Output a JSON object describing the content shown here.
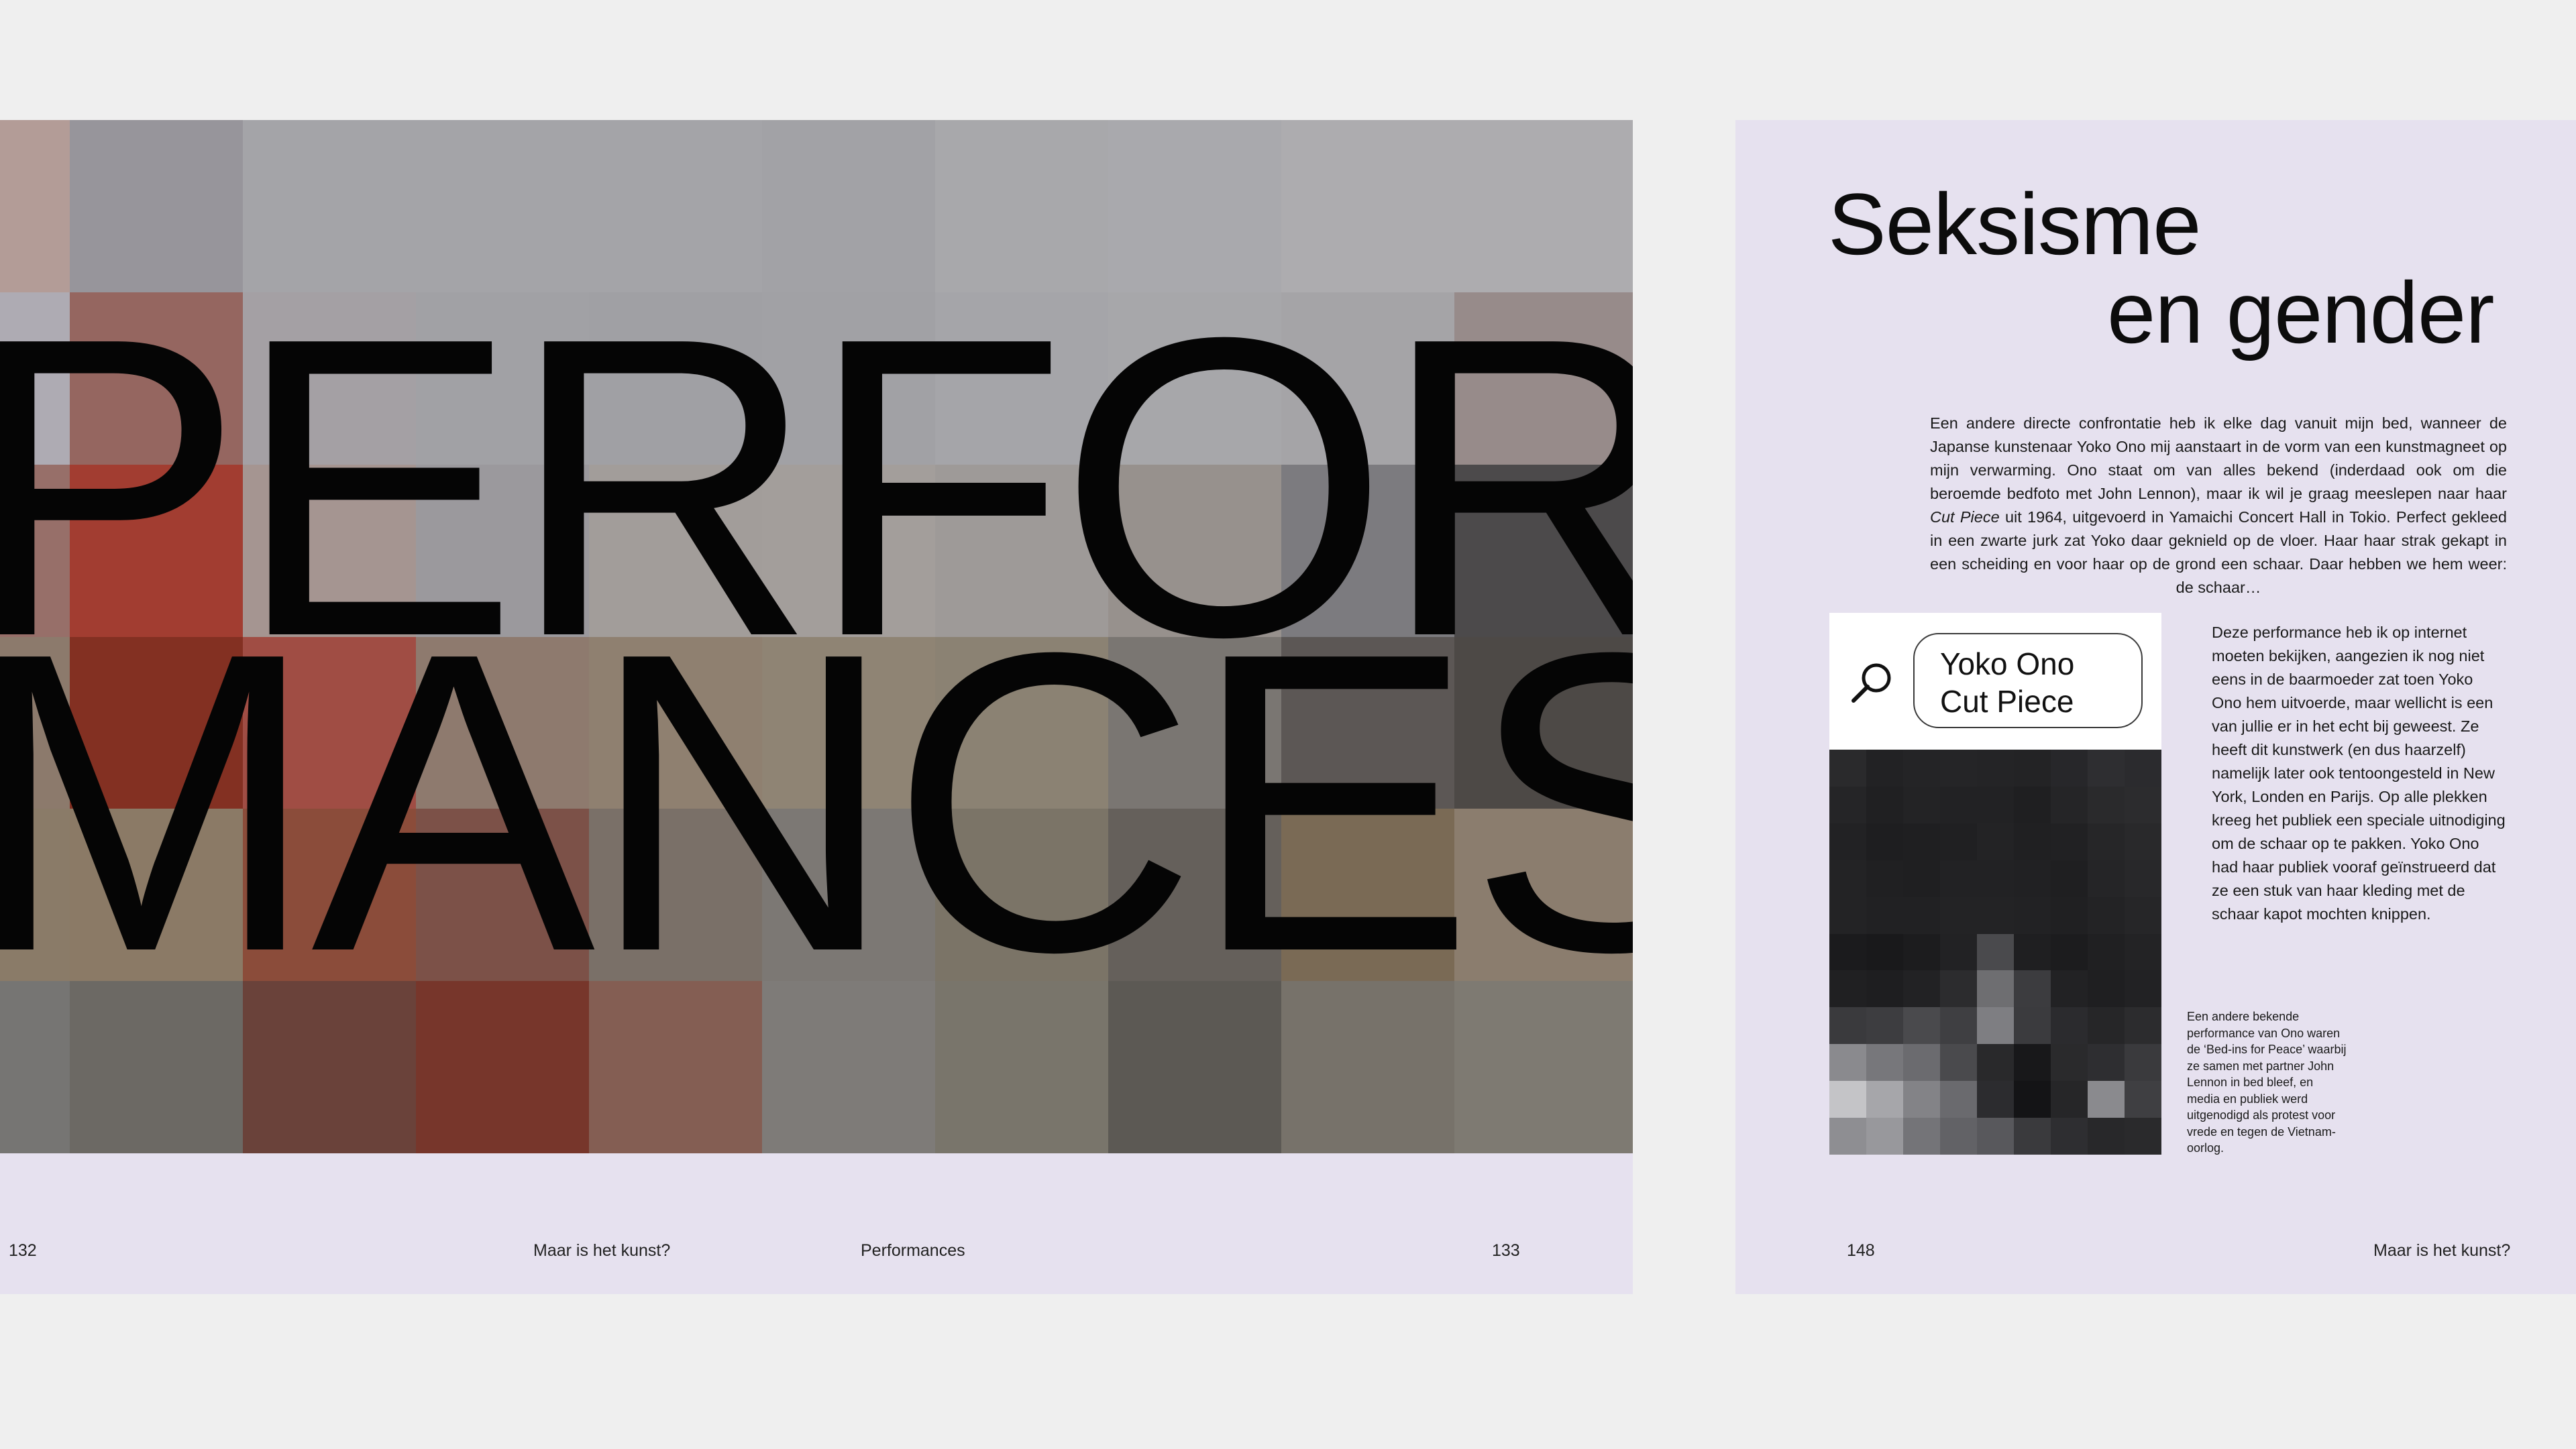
{
  "left_spread": {
    "headline_line1": "PERFOR",
    "headline_line2": "MANCES",
    "folio_left_number": "132",
    "folio_left_title": "Maar is het kunst?",
    "folio_right_title": "Performances",
    "folio_right_number": "133"
  },
  "right_page": {
    "title_line1": "Seksisme",
    "title_line2": "en gender",
    "intro_paragraph_before_italic": "Een andere directe confrontatie heb ik elke dag vanuit mijn bed, wanneer de Japanse kunstenaar Yoko Ono mij aanstaart in de vorm van een kunstmagneet op mijn verwarming. Ono staat om van alles bekend (inderdaad ook om die beroemde bedfoto met John Lennon), maar ik wil je graag meeslepen naar haar ",
    "intro_paragraph_italic": "Cut Piece",
    "intro_paragraph_after_italic": " uit 1964, uitgevoerd in Yamaichi Concert Hall in Tokio. Perfect gekleed in een zwarte jurk zat Yoko daar geknield op de vloer. Haar haar strak gekapt in een scheiding en voor haar op de grond een schaar. Daar hebben we hem weer: de schaar…",
    "second_paragraph": "Deze performance heb ik op internet moeten bekijken, aangezien ik nog niet eens in de baarmoeder zat toen Yoko Ono hem uitvoerde, maar wellicht is een van jullie er in het echt bij geweest. Ze heeft dit kunstwerk (en dus haarzelf) namelijk later ook tentoongesteld in New York, Londen en Parijs. Op alle plekken kreeg het publiek een speciale uitnodiging om de schaar op te pakken. Yoko Ono had haar publiek vooraf geïnstrueerd dat ze een stuk van haar kleding met de schaar kapot mochten knippen.",
    "caption": "Een andere bekende performance van Ono waren de ‘Bed-ins for Peace’ waarbij ze samen met partner John Lennon in bed bleef, en media en publiek werd uitgenodigd als protest voor vrede en tegen de Vietnam-oorlog.",
    "search_query_line1": "Yoko Ono",
    "search_query_line2": "Cut Piece",
    "search_icon": "magnifier-icon",
    "folio_number": "148",
    "folio_title": "Maar is het kunst?"
  },
  "colors": {
    "background": "#efefef",
    "page_tint": "#e6e1ef",
    "headline": "#050505",
    "text": "#1a1a1a"
  }
}
